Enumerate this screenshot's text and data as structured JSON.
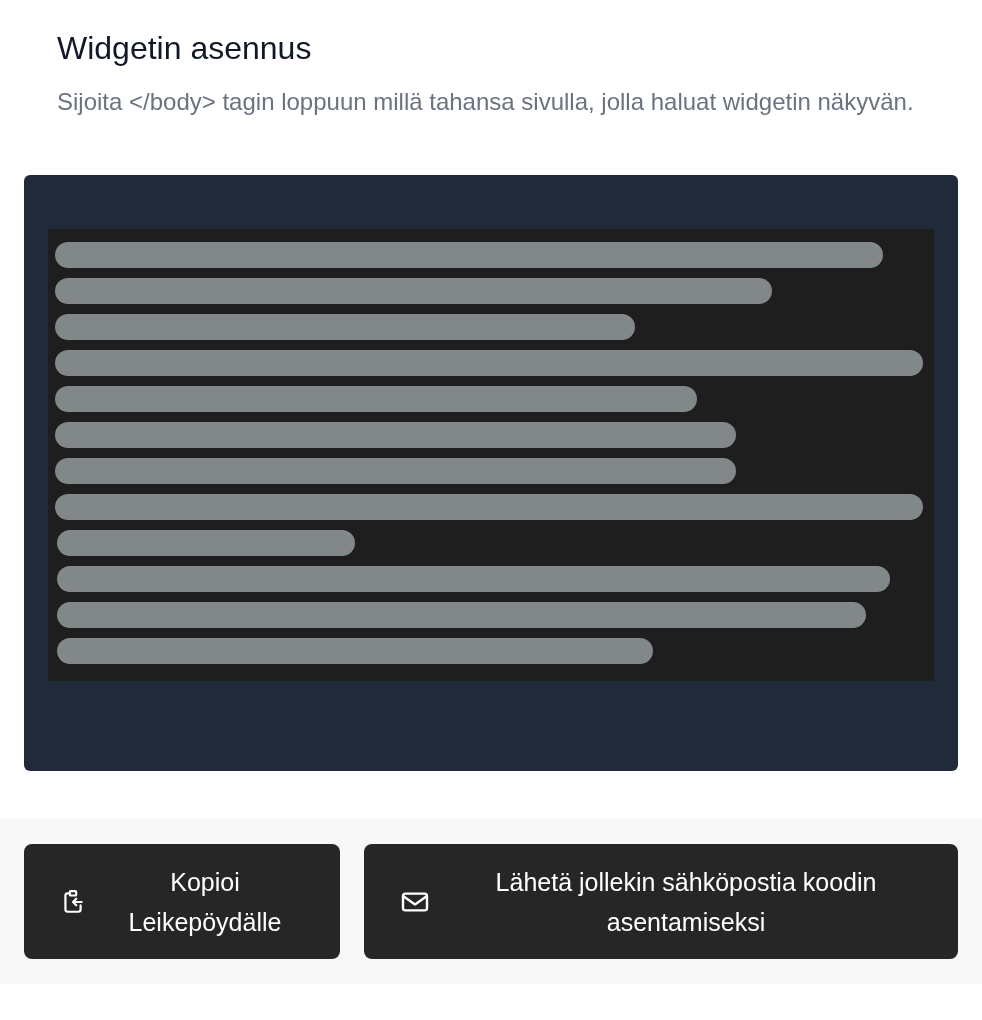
{
  "heading": "Widgetin asennus",
  "description": "Sijoita </body> tagin loppuun millä tahansa sivulla, jolla haluat widgetin näkyvän.",
  "code_block": {
    "kind": "redacted"
  },
  "buttons": [
    {
      "kind": "copy",
      "label": "Kopioi Leikepöydälle"
    },
    {
      "kind": "email",
      "label": "Lähetä jollekin sähköpostia koodin asentamiseksi"
    }
  ]
}
